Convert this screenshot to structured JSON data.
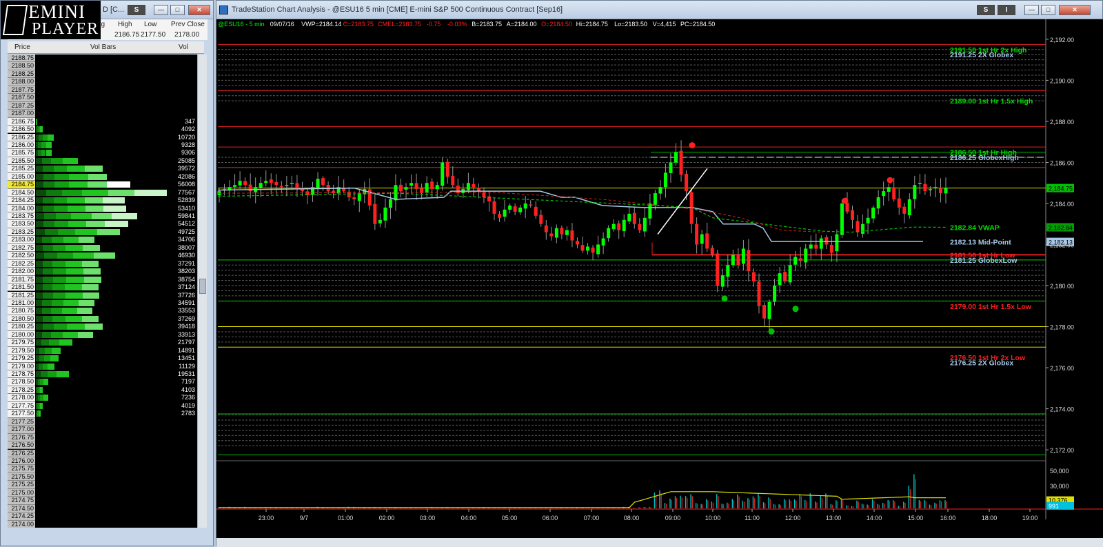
{
  "logo": {
    "line1": "EMINI",
    "line2": "PLAYER"
  },
  "left_window": {
    "title": "D [C...",
    "s_button": "S",
    "quote_headers": [
      "hg",
      "High",
      "Low",
      "Prev Close"
    ],
    "quote_values": [
      "2186.75",
      "2177.50",
      "2178.00"
    ],
    "ladder_headers": [
      "Price",
      "Vol Bars",
      "Vol"
    ],
    "current_price": "2184.75",
    "rows": [
      {
        "p": "2188.75",
        "v": ""
      },
      {
        "p": "2188.50",
        "v": ""
      },
      {
        "p": "2188.25",
        "v": ""
      },
      {
        "p": "2188.00",
        "v": ""
      },
      {
        "p": "2187.75",
        "v": ""
      },
      {
        "p": "2187.50",
        "v": ""
      },
      {
        "p": "2187.25",
        "v": ""
      },
      {
        "p": "2187.00",
        "v": ""
      },
      {
        "p": "2186.75",
        "v": "347"
      },
      {
        "p": "2186.50",
        "v": "4092"
      },
      {
        "p": "2186.25",
        "v": "10720"
      },
      {
        "p": "2186.00",
        "v": "9328"
      },
      {
        "p": "2185.75",
        "v": "9306"
      },
      {
        "p": "2185.50",
        "v": "25085"
      },
      {
        "p": "2185.25",
        "v": "39572"
      },
      {
        "p": "2185.00",
        "v": "42086"
      },
      {
        "p": "2184.75",
        "v": "56008"
      },
      {
        "p": "2184.50",
        "v": "77567"
      },
      {
        "p": "2184.25",
        "v": "52839"
      },
      {
        "p": "2184.00",
        "v": "53410"
      },
      {
        "p": "2183.75",
        "v": "59841"
      },
      {
        "p": "2183.50",
        "v": "54512"
      },
      {
        "p": "2183.25",
        "v": "49725"
      },
      {
        "p": "2183.00",
        "v": "34706"
      },
      {
        "p": "2182.75",
        "v": "38007"
      },
      {
        "p": "2182.50",
        "v": "46930"
      },
      {
        "p": "2182.25",
        "v": "37291"
      },
      {
        "p": "2182.00",
        "v": "38203"
      },
      {
        "p": "2181.75",
        "v": "38754"
      },
      {
        "p": "2181.50",
        "v": "37124"
      },
      {
        "p": "2181.25",
        "v": "37726"
      },
      {
        "p": "2181.00",
        "v": "34591"
      },
      {
        "p": "2180.75",
        "v": "33553"
      },
      {
        "p": "2180.50",
        "v": "37269"
      },
      {
        "p": "2180.25",
        "v": "39418"
      },
      {
        "p": "2180.00",
        "v": "33913"
      },
      {
        "p": "2179.75",
        "v": "21797"
      },
      {
        "p": "2179.50",
        "v": "14891"
      },
      {
        "p": "2179.25",
        "v": "13451"
      },
      {
        "p": "2179.00",
        "v": "11129"
      },
      {
        "p": "2178.75",
        "v": "19531"
      },
      {
        "p": "2178.50",
        "v": "7197"
      },
      {
        "p": "2178.25",
        "v": "4103"
      },
      {
        "p": "2178.00",
        "v": "7236"
      },
      {
        "p": "2177.75",
        "v": "4019"
      },
      {
        "p": "2177.50",
        "v": "2783"
      },
      {
        "p": "2177.25",
        "v": ""
      },
      {
        "p": "2177.00",
        "v": ""
      },
      {
        "p": "2176.75",
        "v": ""
      },
      {
        "p": "2176.50",
        "v": ""
      },
      {
        "p": "2176.25",
        "v": ""
      },
      {
        "p": "2176.00",
        "v": ""
      },
      {
        "p": "2175.75",
        "v": ""
      },
      {
        "p": "2175.50",
        "v": ""
      },
      {
        "p": "2175.25",
        "v": ""
      },
      {
        "p": "2175.00",
        "v": ""
      },
      {
        "p": "2174.75",
        "v": ""
      },
      {
        "p": "2174.50",
        "v": ""
      },
      {
        "p": "2174.25",
        "v": ""
      },
      {
        "p": "2174.00",
        "v": ""
      }
    ]
  },
  "right_window": {
    "title": "TradeStation Chart Analysis - @ESU16 5 min [CME] E-mini S&P 500 Continuous Contract [Sep16]",
    "s_button": "S",
    "i_button": "I"
  },
  "colors": {
    "up": "#00ff00",
    "down": "#ff2020",
    "vwap": "#00c800",
    "globex": "#a8c8e8",
    "yellow": "#ffff00",
    "red": "#ff2020",
    "green": "#00e000"
  },
  "chart_data": {
    "type": "candlestick",
    "symbol": "@ESU16 - 5 min",
    "status_items": [
      {
        "text": "@ESU16 - 5 min",
        "color": "#00ff00"
      },
      {
        "text": "09/07/16",
        "color": "#ffffff"
      },
      {
        "text": "VWP=2184.14",
        "color": "#ffffff"
      },
      {
        "text": "C=2183.75",
        "color": "#ff2020"
      },
      {
        "text": "CME",
        "color": "#ff2020"
      },
      {
        "text": "L=2183.75",
        "color": "#ff2020"
      },
      {
        "text": "-0.75",
        "color": "#ff2020"
      },
      {
        "text": "-0.03%",
        "color": "#ff2020"
      },
      {
        "text": "B=2183.75",
        "color": "#ffffff"
      },
      {
        "text": "A=2184.00",
        "color": "#ffffff"
      },
      {
        "text": "O=2184.50",
        "color": "#ff2020"
      },
      {
        "text": "Hi=2184.75",
        "color": "#ffffff"
      },
      {
        "text": "Lo=2183.50",
        "color": "#ffffff"
      },
      {
        "text": "V=4,415",
        "color": "#ffffff"
      },
      {
        "text": "PC=2184.50",
        "color": "#ffffff"
      }
    ],
    "ylim": [
      2171.5,
      2192.5
    ],
    "y_ticks": [
      "2,192.00",
      "2,190.00",
      "2,188.00",
      "2,186.00",
      "2,184.00",
      "2,182.00",
      "2,180.00",
      "2,178.00",
      "2,176.00",
      "2,174.00",
      "2,172.00"
    ],
    "y_tick_values": [
      2192,
      2190,
      2188,
      2186,
      2184,
      2182,
      2180,
      2178,
      2176,
      2174,
      2172
    ],
    "x_ticks": [
      "23:00",
      "9/7",
      "01:00",
      "02:00",
      "03:00",
      "04:00",
      "05:00",
      "06:00",
      "07:00",
      "08:00",
      "09:00",
      "10:00",
      "11:00",
      "12:00",
      "13:00",
      "14:00",
      "15:00",
      "16:00",
      "18:00",
      "19:00"
    ],
    "levels": [
      {
        "value": 2191.5,
        "label": "2191.50 1st Hr  2x High",
        "color": "#00e000",
        "line": "#e02020"
      },
      {
        "value": 2191.25,
        "label": "2191.25 2X Globex",
        "color": "#a8c8e8",
        "line": ""
      },
      {
        "value": 2189.0,
        "label": "2189.00 1st Hr  1.5x High",
        "color": "#00e000",
        "line": "#e02020"
      },
      {
        "value": 2186.5,
        "label": "2186.50 1st Hr  High",
        "color": "#00e000",
        "line": "#00c000"
      },
      {
        "value": 2186.25,
        "label": "2186.25 GlobexHigh",
        "color": "#a8c8e8",
        "line": "#8899aa"
      },
      {
        "value": 2182.84,
        "label": "2182.84 VWAP",
        "color": "#00e000",
        "line": ""
      },
      {
        "value": 2182.13,
        "label": "2182.13 Mid-Point",
        "color": "#a8c8e8",
        "line": ""
      },
      {
        "value": 2181.5,
        "label": "2181.50 1st Hr  Low",
        "color": "#ff2020",
        "line": "#e02020"
      },
      {
        "value": 2181.25,
        "label": "2181.25 GlobexLow",
        "color": "#a8c8e8",
        "line": "#00c000"
      },
      {
        "value": 2179.0,
        "label": "2179.00 1st Hr  1.5x Low",
        "color": "#ff2020",
        "line": "#00c000"
      },
      {
        "value": 2176.5,
        "label": "2176.50 1st Hr  2x Low",
        "color": "#ff2020",
        "line": ""
      },
      {
        "value": 2176.25,
        "label": "2176.25 2X Globex",
        "color": "#a8c8e8",
        "line": ""
      }
    ],
    "right_tags": [
      {
        "value": 2184.75,
        "label": "2,184.75",
        "bg": "#00c000",
        "fg": "#000000"
      },
      {
        "value": 2182.84,
        "label": "2,182.84",
        "bg": "#00a000",
        "fg": "#000000"
      },
      {
        "value": 2182.13,
        "label": "2,182.13",
        "bg": "#a8c8e8",
        "fg": "#000000"
      }
    ],
    "volume": {
      "ticks": [
        "50,000",
        "30,000",
        "10,000"
      ],
      "tick_values": [
        50000,
        30000,
        10000
      ],
      "ymax": 60000,
      "last_volume": "10,376",
      "last_avg": "991"
    },
    "closes_path": [
      2184.6,
      2184.7,
      2184.8,
      2184.9,
      2185.1,
      2184.9,
      2184.6,
      2184.8,
      2185.0,
      2185.1,
      2185.0,
      2184.9,
      2184.8,
      2184.9,
      2185.0,
      2184.7,
      2184.6,
      2184.4,
      2184.8,
      2185.2,
      2184.9,
      2184.6,
      2184.5,
      2184.8,
      2184.6,
      2184.3,
      2184.2,
      2184.5,
      2184.7,
      2183.9,
      2183.0,
      2183.2,
      2183.8,
      2184.2,
      2184.9,
      2184.6,
      2184.8,
      2185.0,
      2184.7,
      2184.5,
      2185.0,
      2184.7,
      2184.9,
      2186.0,
      2185.3,
      2184.9,
      2184.5,
      2184.7,
      2185.0,
      2184.8,
      2184.6,
      2184.3,
      2184.1,
      2183.5,
      2183.3,
      2183.7,
      2183.9,
      2183.6,
      2183.8,
      2184.0,
      2183.9,
      2183.4,
      2183.0,
      2182.6,
      2182.4,
      2182.8,
      2182.5,
      2182.7,
      2182.2,
      2182.0,
      2181.7,
      2181.9,
      2181.6,
      2182.0,
      2182.3,
      2182.8,
      2183.0,
      2182.7,
      2183.2,
      2183.5,
      2183.0,
      2182.7,
      2183.3,
      2184.0,
      2184.5,
      2184.8,
      2185.5,
      2186.0,
      2186.5,
      2185.4,
      2184.6,
      2183.0,
      2182.0,
      2182.5,
      2181.8,
      2181.5,
      2180.0,
      2180.5,
      2181.0,
      2181.5,
      2181.0,
      2181.8,
      2180.7,
      2180.2,
      2179.0,
      2178.4,
      2179.2,
      2180.0,
      2180.6,
      2180.2,
      2181.0,
      2181.4,
      2181.2,
      2181.8,
      2182.0,
      2181.8,
      2182.3,
      2182.0,
      2181.6,
      2182.5,
      2184.0,
      2183.6,
      2183.2,
      2182.6,
      2183.0,
      2183.3,
      2183.8,
      2184.3,
      2184.6,
      2184.8,
      2184.2,
      2183.8,
      2183.5,
      2184.2,
      2184.9,
      2185.0,
      2184.6,
      2184.7,
      2184.8,
      2184.5,
      2184.75
    ]
  }
}
